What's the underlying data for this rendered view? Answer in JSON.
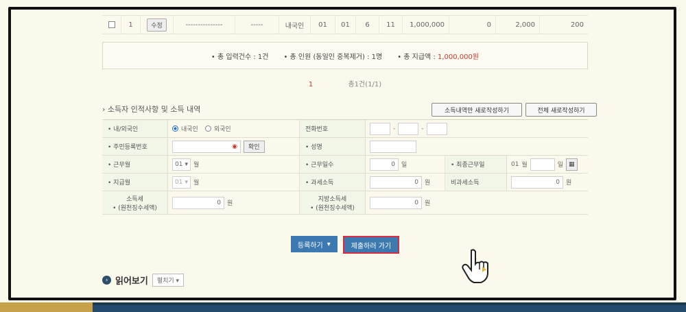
{
  "top_row": {
    "index": "1",
    "edit_label": "수정",
    "dashes1": "---------------",
    "dashes2": "-----",
    "type": "내국인",
    "m1": "01",
    "m2": "01",
    "days": "6",
    "n": "11",
    "amount": "1,000,000",
    "zero": "0",
    "tax": "2,000",
    "local": "200"
  },
  "summary": {
    "entries": "• 총 입력건수 : 1건",
    "people": "• 총 인원 (동일인 중복제거) : 1명",
    "pay_label": "• 총 지급액 :",
    "pay_value": "1,000,000원"
  },
  "pager": {
    "page": "1",
    "info": "총1건(1/1)"
  },
  "section": {
    "title": "› 소득자 인적사항 및 소득 내역",
    "btn_income_only": "소득내역만 새로작성하기",
    "btn_all_new": "전체 새로작성하기"
  },
  "form": {
    "nat_label": "• 내/외국인",
    "domestic": "내국인",
    "foreign": "외국인",
    "phone_label": "전화번호",
    "rrn_label": "• 주민등록번호",
    "confirm": "확인",
    "name_label": "• 성명",
    "work_month_label": "• 근무월",
    "work_month_val": "01",
    "month_unit": "월",
    "work_days_label": "• 근무일수",
    "work_days_val": "0",
    "day_unit": "일",
    "last_day_label": "• 최종근무일",
    "last_day_month": "01",
    "pay_month_label": "• 지급월",
    "pay_month_val": "01",
    "taxable_label": "• 과세소득",
    "taxable_val": "0",
    "won": "원",
    "nontax_label": "비과세소득",
    "nontax_val": "0",
    "income_tax_label1": "소득세",
    "income_tax_label2": "• (원천징수세액)",
    "income_tax_val": "0",
    "local_tax_label1": "지방소득세",
    "local_tax_label2": "• (원천징수세액)",
    "local_tax_val": "0"
  },
  "actions": {
    "register": "등록하기",
    "submit": "제출하러 가기"
  },
  "read": {
    "title": "읽어보기",
    "dropdown": "펼치기"
  }
}
